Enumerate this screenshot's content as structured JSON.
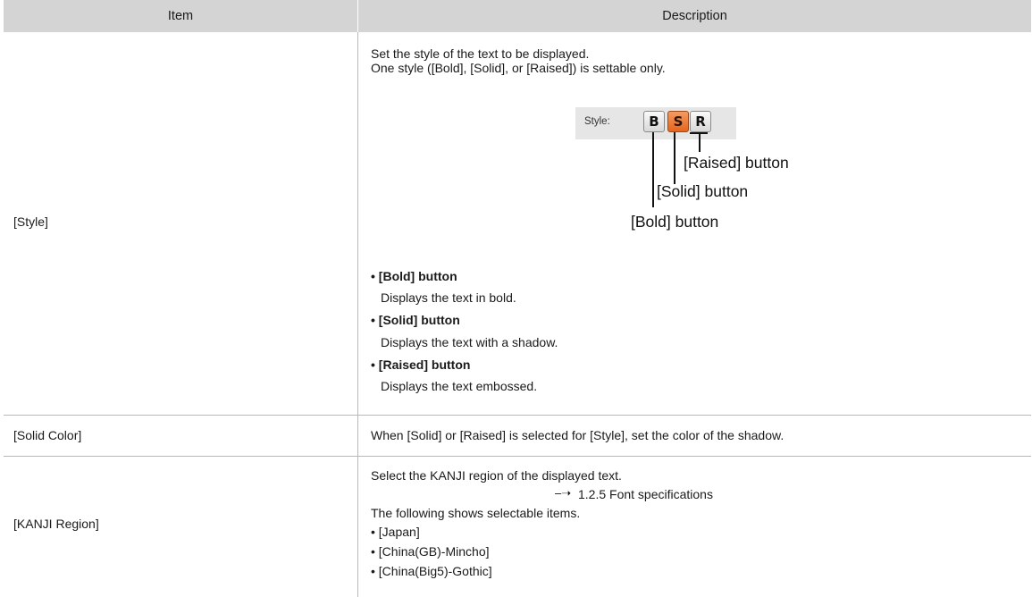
{
  "table": {
    "header": {
      "item": "Item",
      "description": "Description"
    },
    "rows": [
      {
        "item": "[Style]",
        "desc_line1": "Set the style of the text to be displayed.",
        "desc_line2": "One style ([Bold], [Solid], or [Raised]) is settable only.",
        "figure": {
          "style_label": "Style:",
          "bold_glyph": "B",
          "solid_glyph": "S",
          "raised_glyph": "R",
          "raised_callout": "[Raised] button",
          "solid_callout": "[Solid] button",
          "bold_callout": "[Bold] button",
          "solid_button_color": "#e8702a"
        },
        "bullets": [
          {
            "title": "• [Bold] button",
            "text": "Displays the text in bold."
          },
          {
            "title": "• [Solid] button",
            "text": "Displays the text with a shadow."
          },
          {
            "title": "• [Raised] button",
            "text": "Displays the text embossed."
          }
        ]
      },
      {
        "item": "[Solid Color]",
        "desc": "When [Solid] or [Raised] is selected for [Style], set the color of the shadow."
      },
      {
        "item": "[KANJI Region]",
        "desc_line1": "Select the KANJI region of the displayed text.",
        "reference": "1.2.5 Font specifications",
        "desc_line2": "The following shows selectable items.",
        "options": [
          "• [Japan]",
          "• [China(GB)-Mincho]",
          "• [China(Big5)-Gothic]"
        ]
      }
    ]
  }
}
